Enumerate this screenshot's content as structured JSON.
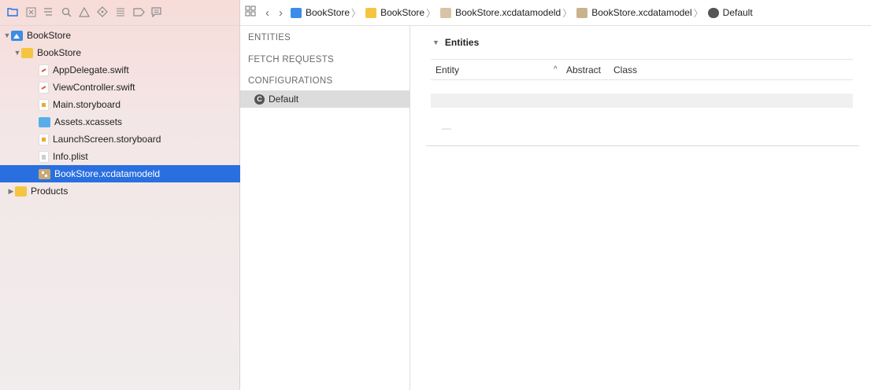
{
  "navigator": {
    "toolbar_icons": [
      "folder-icon",
      "source-control-icon",
      "symbol-icon",
      "find-icon",
      "issue-icon",
      "test-icon",
      "debug-icon",
      "breakpoint-icon",
      "report-icon"
    ],
    "items": [
      {
        "label": "BookStore",
        "icon": "project-icon",
        "disclosure": "▼",
        "selected": false
      },
      {
        "label": "BookStore",
        "icon": "folder-icon",
        "disclosure": "▼",
        "selected": false
      },
      {
        "label": "AppDelegate.swift",
        "icon": "swift-file-icon",
        "disclosure": "",
        "selected": false
      },
      {
        "label": "ViewController.swift",
        "icon": "swift-file-icon",
        "disclosure": "",
        "selected": false
      },
      {
        "label": "Main.storyboard",
        "icon": "storyboard-icon",
        "disclosure": "",
        "selected": false
      },
      {
        "label": "Assets.xcassets",
        "icon": "assets-icon",
        "disclosure": "",
        "selected": false
      },
      {
        "label": "LaunchScreen.storyboard",
        "icon": "storyboard-icon",
        "disclosure": "",
        "selected": false
      },
      {
        "label": "Info.plist",
        "icon": "plist-icon",
        "disclosure": "",
        "selected": false
      },
      {
        "label": "BookStore.xcdatamodeld",
        "icon": "datamodel-icon",
        "disclosure": "",
        "selected": true
      },
      {
        "label": "Products",
        "icon": "folder-icon",
        "disclosure": "▶",
        "selected": false
      }
    ]
  },
  "jumpbar": {
    "crumbs": [
      "BookStore",
      "BookStore",
      "BookStore.xcdatamodeld",
      "BookStore.xcdatamodel",
      "Default"
    ]
  },
  "outline": {
    "entities": "ENTITIES",
    "fetch_requests": "FETCH REQUESTS",
    "configurations": "CONFIGURATIONS",
    "default_config": "Default",
    "default_icon_letter": "C"
  },
  "editor": {
    "section_title": "Entities",
    "columns": {
      "entity": "Entity",
      "abstract": "Abstract",
      "class": "Class"
    },
    "empty_marker": "—"
  },
  "colors": {
    "selection": "#2a6fe0",
    "navigator_bg": "#f3e6e6",
    "folder": "#f5c542"
  }
}
